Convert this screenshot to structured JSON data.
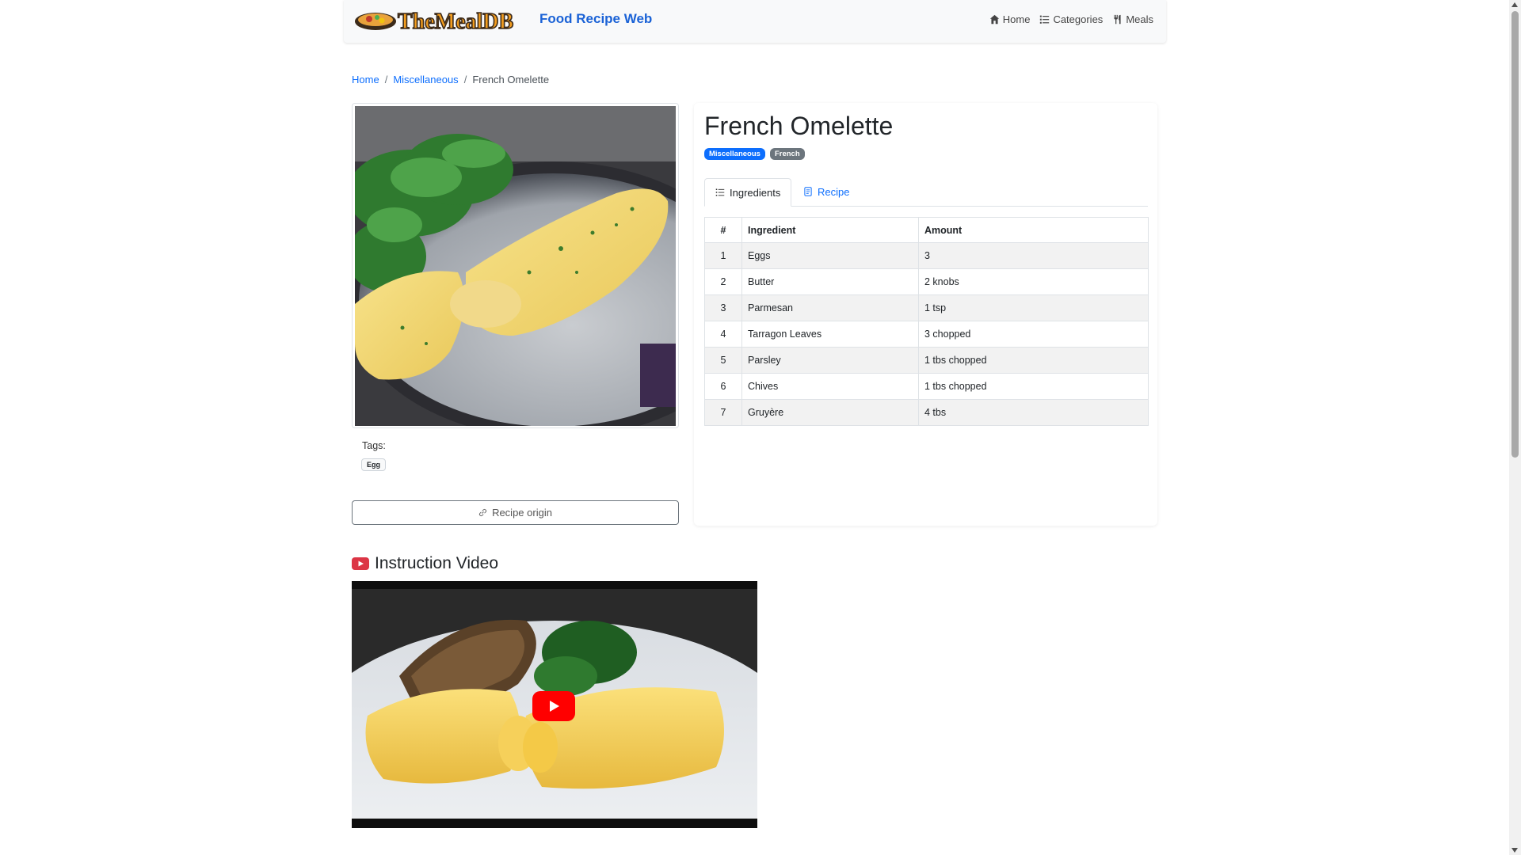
{
  "navbar": {
    "logo_text": "TheMealDB",
    "site_title": "Food Recipe Web",
    "links": [
      {
        "label": "Home",
        "icon": "home-icon"
      },
      {
        "label": "Categories",
        "icon": "list-icon"
      },
      {
        "label": "Meals",
        "icon": "utensils-icon"
      }
    ]
  },
  "breadcrumb": {
    "home": "Home",
    "category": "Miscellaneous",
    "current": "French Omelette",
    "separator": "/"
  },
  "meal": {
    "title": "French Omelette",
    "category_badge": "Miscellaneous",
    "area_badge": "French",
    "tags_label": "Tags:",
    "tags": [
      "Egg"
    ],
    "origin_button": "Recipe origin"
  },
  "tabs": {
    "ingredients": "Ingredients",
    "recipe": "Recipe"
  },
  "ingredients_table": {
    "headers": [
      "#",
      "Ingredient",
      "Amount"
    ],
    "rows": [
      [
        "1",
        "Eggs",
        "3"
      ],
      [
        "2",
        "Butter",
        "2 knobs"
      ],
      [
        "3",
        "Parmesan",
        "1 tsp"
      ],
      [
        "4",
        "Tarragon Leaves",
        "3 chopped"
      ],
      [
        "5",
        "Parsley",
        "1 tbs chopped"
      ],
      [
        "6",
        "Chives",
        "1 tbs chopped"
      ],
      [
        "7",
        "Gruyère",
        "4 tbs"
      ]
    ]
  },
  "video": {
    "heading": "Instruction Video"
  },
  "colors": {
    "link": "#0d6efd",
    "brand_blue": "#1a62d6",
    "youtube_red": "#ff0000",
    "badge_gray": "#6c757d"
  }
}
